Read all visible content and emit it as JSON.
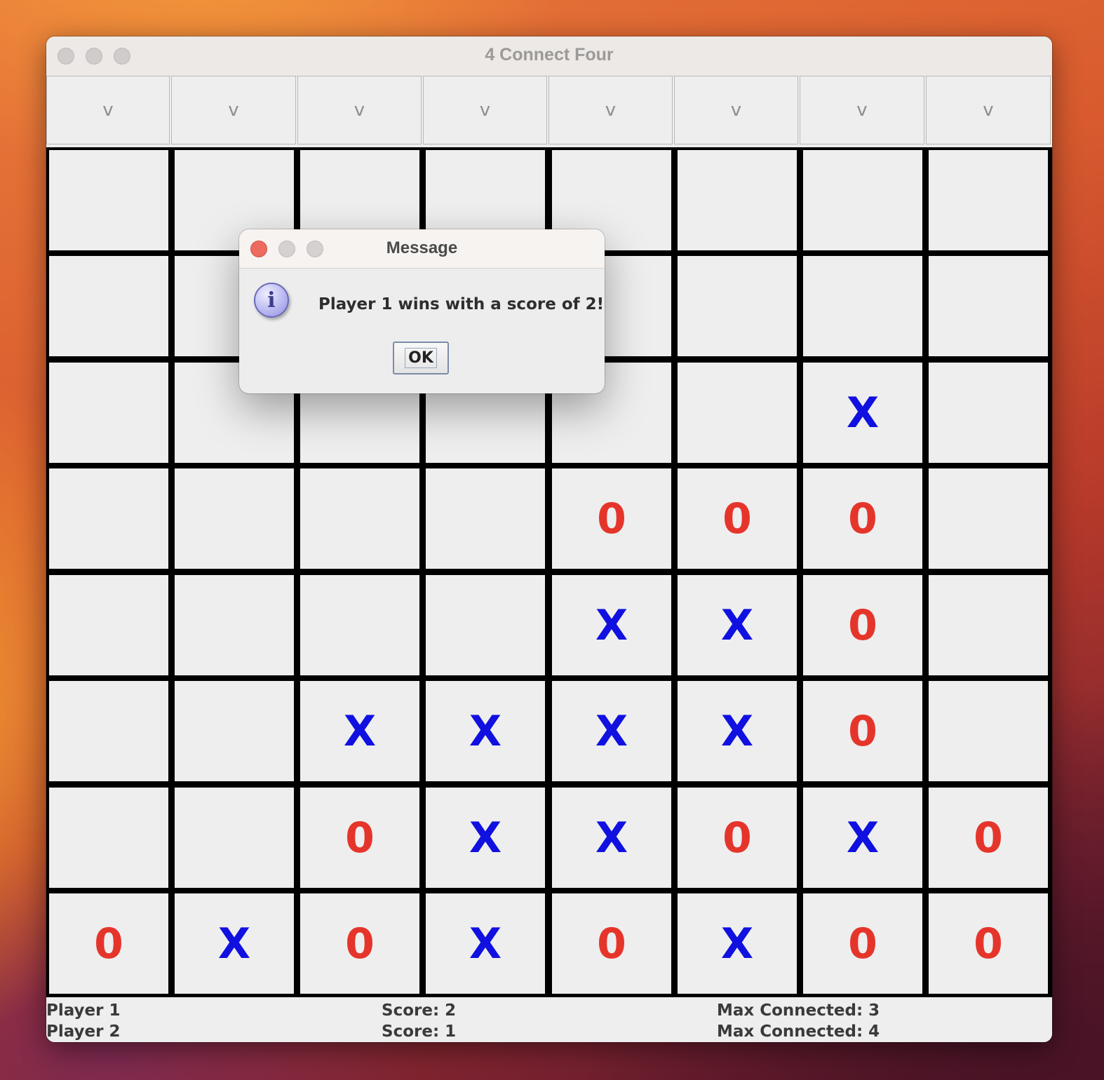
{
  "window": {
    "title": "4 Connect Four"
  },
  "columns": [
    "v",
    "v",
    "v",
    "v",
    "v",
    "v",
    "v",
    "v"
  ],
  "board": [
    [
      "",
      "",
      "",
      "",
      "",
      "",
      "",
      ""
    ],
    [
      "",
      "",
      "",
      "",
      "",
      "",
      "",
      ""
    ],
    [
      "",
      "",
      "",
      "",
      "",
      "",
      "X",
      ""
    ],
    [
      "",
      "",
      "",
      "",
      "0",
      "0",
      "0",
      ""
    ],
    [
      "",
      "",
      "",
      "",
      "X",
      "X",
      "0",
      ""
    ],
    [
      "",
      "",
      "X",
      "X",
      "X",
      "X",
      "0",
      ""
    ],
    [
      "",
      "",
      "0",
      "X",
      "X",
      "0",
      "X",
      "0"
    ],
    [
      "0",
      "X",
      "0",
      "X",
      "0",
      "X",
      "0",
      "0"
    ]
  ],
  "colors": {
    "X": "#1010e0",
    "0": "#e5352b"
  },
  "players": [
    {
      "name": "Player 1",
      "score": "Score: 2",
      "max": "Max Connected: 3"
    },
    {
      "name": "Player 2",
      "score": "Score: 1",
      "max": "Max Connected: 4"
    }
  ],
  "dialog": {
    "title": "Message",
    "icon": "info-icon",
    "icon_glyph": "i",
    "message": "Player 1 wins with a score of 2!",
    "ok_label": "OK"
  }
}
